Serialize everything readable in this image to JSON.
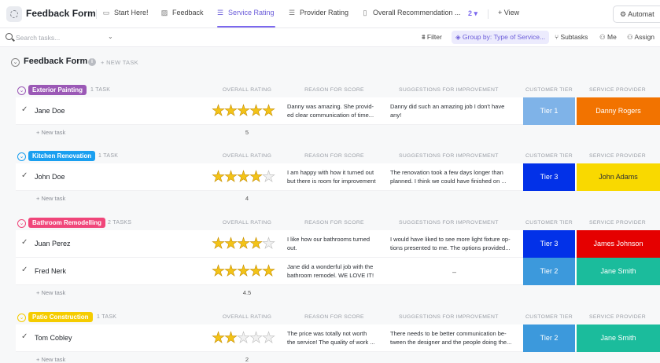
{
  "app": {
    "title": "Feedback Form"
  },
  "tabs": [
    {
      "label": "Start Here!",
      "icon": "document-icon"
    },
    {
      "label": "Feedback",
      "icon": "form-icon"
    },
    {
      "label": "Service Rating",
      "icon": "list-icon",
      "active": true
    },
    {
      "label": "Provider Rating",
      "icon": "list-icon"
    },
    {
      "label": "Overall Recommendation ...",
      "icon": "doc-icon"
    }
  ],
  "more_views_count": "2",
  "add_view_label": "+ View",
  "automate_label": "Automat",
  "toolbar": {
    "search_placeholder": "Search tasks...",
    "filter_label": "Filter",
    "group_by_label": "Group by: Type of Service...",
    "subtasks_label": "Subtasks",
    "me_label": "Me",
    "assign_label": "Assign"
  },
  "list": {
    "title": "Feedback Form",
    "new_task_label": "+ NEW TASK"
  },
  "columns": {
    "overall_rating": "OVERALL RATING",
    "reason": "REASON FOR SCORE",
    "suggestions": "SUGGESTIONS FOR IMPROVEMENT",
    "tier": "CUSTOMER TIER",
    "provider": "SERVICE PROVIDER"
  },
  "new_task_row_label": "+ New task",
  "colors": {
    "accent": "#7b68ee",
    "tier_1": "#7fb3e8",
    "tier_2": "#3c99dc",
    "tier_3": "#0231e8",
    "provider_orange": "#f27300",
    "provider_yellow": "#f9d900",
    "provider_red": "#e50000",
    "provider_teal": "#1bbc9c"
  },
  "groups": [
    {
      "name": "Exterior Painting",
      "count_label": "1 TASK",
      "color": "#9b59b6",
      "average": "5",
      "tasks": [
        {
          "name": "Jane Doe",
          "rating": 5,
          "reason": [
            "Danny was amazing. She provid-",
            "ed clear communication of time..."
          ],
          "suggestion": [
            "Danny did such an amazing job I don't have",
            "any!"
          ],
          "tier": "Tier 1",
          "tier_color": "#7fb3e8",
          "provider": "Danny Rogers",
          "provider_color": "#f27300",
          "provider_text": "#ffffff"
        }
      ]
    },
    {
      "name": "Kitchen Renovation",
      "count_label": "1 TASK",
      "color": "#1a9ff0",
      "average": "4",
      "tasks": [
        {
          "name": "John Doe",
          "rating": 4,
          "reason": [
            "I am happy with how it turned out",
            "but there is room for improvement"
          ],
          "suggestion": [
            "The renovation took a few days longer than",
            "planned. I think we could have finished on ..."
          ],
          "tier": "Tier 3",
          "tier_color": "#0231e8",
          "provider": "John Adams",
          "provider_color": "#f9d900",
          "provider_text": "#2a2e34"
        }
      ]
    },
    {
      "name": "Bathroom Remodelling",
      "count_label": "2 TASKS",
      "color": "#f0467a",
      "average": "4.5",
      "tasks": [
        {
          "name": "Juan Perez",
          "rating": 4,
          "reason": [
            "I like how our bathrooms turned",
            "out."
          ],
          "suggestion": [
            "I would have liked to see more light fixture op-",
            "tions presented to me. The options provided..."
          ],
          "tier": "Tier 3",
          "tier_color": "#0231e8",
          "provider": "James Johnson",
          "provider_color": "#e50000",
          "provider_text": "#ffffff"
        },
        {
          "name": "Fred Nerk",
          "rating": 5,
          "reason": [
            "Jane did a wonderful job with the",
            "bathroom remodel. WE LOVE IT!"
          ],
          "suggestion": [],
          "tier": "Tier 2",
          "tier_color": "#3c99dc",
          "provider": "Jane Smith",
          "provider_color": "#1bbc9c",
          "provider_text": "#ffffff"
        }
      ]
    },
    {
      "name": "Patio Construction",
      "count_label": "1 TASK",
      "color": "#f5cc00",
      "average": "2",
      "tasks": [
        {
          "name": "Tom Cobley",
          "rating": 2,
          "reason": [
            "The price was totally not worth",
            "the service! The quality of work ..."
          ],
          "suggestion": [
            "There needs to be better communication be-",
            "tween the designer and the people doing the..."
          ],
          "tier": "Tier 2",
          "tier_color": "#3c99dc",
          "provider": "Jane Smith",
          "provider_color": "#1bbc9c",
          "provider_text": "#ffffff"
        }
      ]
    }
  ],
  "empty_suggestion": "–"
}
